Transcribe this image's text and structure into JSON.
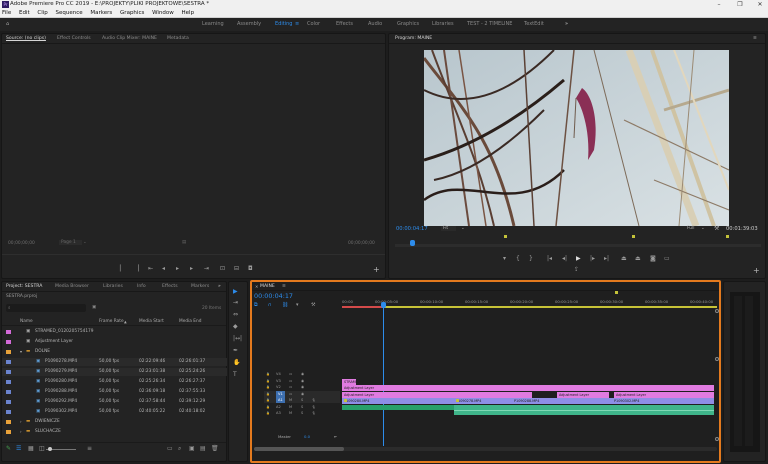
{
  "titlebar": {
    "title": "Adobe Premiere Pro CC 2019 - E:\\PROJEKTY\\PLIKI PROJEKTOWE\\SESTRA *"
  },
  "menubar": {
    "items": [
      "File",
      "Edit",
      "Clip",
      "Sequence",
      "Markers",
      "Graphics",
      "Window",
      "Help"
    ]
  },
  "workspaces": {
    "items": [
      "Learning",
      "Assembly",
      "Editing",
      "Color",
      "Effects",
      "Audio",
      "Graphics",
      "Libraries",
      "TEST - 2 TIMELINE",
      "TextEdit"
    ],
    "active": "Editing",
    "more": "»"
  },
  "source_panel": {
    "tabs": [
      "Source: (no clips)",
      "Effect Controls",
      "Audio Clip Mixer: MAINE",
      "Metadata"
    ],
    "timecode_left": "00;00;00;00",
    "timecode_right": "00;00;00;00",
    "page_label": "Page 1"
  },
  "program_panel": {
    "title": "Program: MAINE",
    "timecode": "00:00:04:17",
    "fit": "Fit",
    "quality": "Full",
    "duration": "00:01:39:03"
  },
  "project_panel": {
    "tabs": [
      "Project: SESTRA",
      "Media Browser",
      "Libraries",
      "Info",
      "Effects",
      "Markers"
    ],
    "project_file": "SESTRA.prproj",
    "items_count": "20 Items",
    "columns": [
      "Name",
      "Frame Rate",
      "Media Start",
      "Media End"
    ],
    "rows": [
      {
        "name": "STRAMED_0120205754179",
        "fr": "",
        "start": "",
        "end": "",
        "color": "#d46ad8",
        "indent": 0
      },
      {
        "name": "Adjustment Layer",
        "fr": "",
        "start": "",
        "end": "",
        "color": "#d46ad8",
        "indent": 0
      },
      {
        "name": "DOLNE",
        "fr": "",
        "start": "",
        "end": "",
        "color": "#e8a23a",
        "indent": 0
      },
      {
        "name": "P1090278.MP4",
        "fr": "50,00 fps",
        "start": "02:22:09:46",
        "end": "02:26:01:37",
        "color": "#6b84cf",
        "indent": 1
      },
      {
        "name": "P1090279.MP4",
        "fr": "50,00 fps",
        "start": "02:23:01:38",
        "end": "02:25:24:26",
        "color": "#6b84cf",
        "indent": 1
      },
      {
        "name": "P1090280.MP4",
        "fr": "50,00 fps",
        "start": "02:25:26:34",
        "end": "02:26:27:37",
        "color": "#6b84cf",
        "indent": 1
      },
      {
        "name": "P1090288.MP4",
        "fr": "50,00 fps",
        "start": "02:36:09:18",
        "end": "02:37:55:33",
        "color": "#6b84cf",
        "indent": 1
      },
      {
        "name": "P1090292.MP4",
        "fr": "50,00 fps",
        "start": "02:37:58:44",
        "end": "02:39:12:29",
        "color": "#6b84cf",
        "indent": 1
      },
      {
        "name": "P1090302.MP4",
        "fr": "50,00 fps",
        "start": "02:40:05:22",
        "end": "02:40:18:02",
        "color": "#6b84cf",
        "indent": 1
      },
      {
        "name": "DWIENICZE",
        "fr": "",
        "start": "",
        "end": "",
        "color": "#e8a23a",
        "indent": 0
      },
      {
        "name": "SLUCHACZE",
        "fr": "",
        "start": "",
        "end": "",
        "color": "#e8a23a",
        "indent": 0
      }
    ]
  },
  "timeline": {
    "tab": "MAINE",
    "timecode": "00:00:04:17",
    "ruler": [
      "00:00",
      "00:00:05:00",
      "00:00:10:00",
      "00:00:15:00",
      "00:00:20:00",
      "00:00:25:00",
      "00:00:30:00",
      "00:00:35:00",
      "00:00:40:00"
    ],
    "tracks": [
      {
        "name": "V4",
        "kind": "v"
      },
      {
        "name": "V3",
        "kind": "v"
      },
      {
        "name": "V2",
        "kind": "v"
      },
      {
        "name": "V1",
        "kind": "v"
      },
      {
        "name": "A1",
        "kind": "a"
      },
      {
        "name": "A2",
        "kind": "a"
      },
      {
        "name": "A3",
        "kind": "a"
      }
    ],
    "master": "Master",
    "master_value": "0.0",
    "clips": {
      "v4": "STRAMED_01",
      "v3": "Adjustment Layer",
      "v2_a": "Adjustment Layer",
      "v2_b": "Adjustment Layer",
      "v2_c": "Adjustment Layer",
      "v1_a": "P1090280.MP4",
      "v1_b": "P1090278.MP4",
      "v1_c": "P1090288.MP4",
      "v1_d": "P1090302.MP4"
    }
  },
  "colors": {
    "accent": "#2d8ceb",
    "highlight_border": "#e47a1e",
    "pink_clip": "#e07be0",
    "teal_clip": "#3fb58a",
    "purple_clip": "#8e8ee6",
    "green_audio": "#27a06a"
  }
}
